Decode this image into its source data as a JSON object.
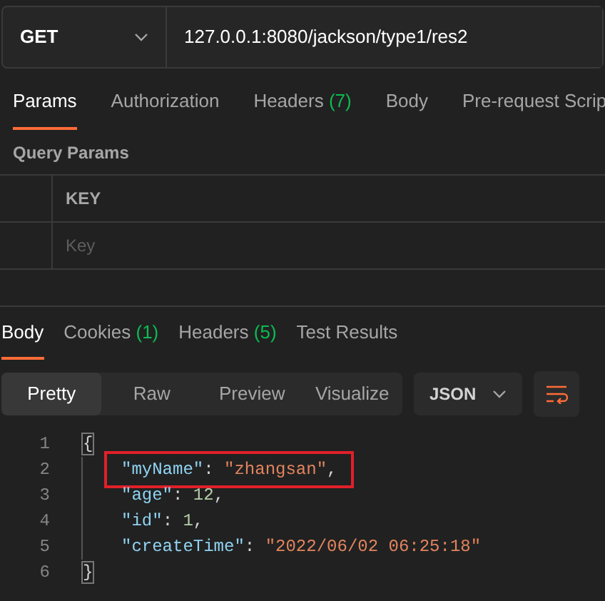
{
  "request": {
    "method": "GET",
    "url": "127.0.0.1:8080/jackson/type1/res2"
  },
  "request_tabs": [
    {
      "label": "Params",
      "selected": true
    },
    {
      "label": "Authorization",
      "selected": false
    },
    {
      "label": "Headers",
      "count": "(7)",
      "selected": false
    },
    {
      "label": "Body",
      "selected": false
    },
    {
      "label": "Pre-request Scrip",
      "selected": false
    }
  ],
  "query_params": {
    "title": "Query Params",
    "columns": [
      "KEY"
    ],
    "key_placeholder": "Key"
  },
  "response_tabs": [
    {
      "label": "Body",
      "selected": true
    },
    {
      "label": "Cookies",
      "count": "(1)",
      "selected": false
    },
    {
      "label": "Headers",
      "count": "(5)",
      "selected": false
    },
    {
      "label": "Test Results",
      "selected": false
    }
  ],
  "view_modes": [
    {
      "label": "Pretty",
      "selected": true
    },
    {
      "label": "Raw",
      "selected": false
    },
    {
      "label": "Preview",
      "selected": false
    },
    {
      "label": "Visualize",
      "selected": false
    }
  ],
  "format": "JSON",
  "code_lines": [
    {
      "number": "1",
      "highlighted": false,
      "tokens": [
        {
          "kind": "brace",
          "text": "{"
        }
      ]
    },
    {
      "number": "2",
      "highlighted": true,
      "tokens": [
        {
          "kind": "key",
          "text": "\"myName\""
        },
        {
          "kind": "punct",
          "text": ": "
        },
        {
          "kind": "string",
          "text": "\"zhangsan\""
        },
        {
          "kind": "punct",
          "text": ","
        }
      ]
    },
    {
      "number": "3",
      "highlighted": false,
      "tokens": [
        {
          "kind": "key",
          "text": "\"age\""
        },
        {
          "kind": "punct",
          "text": ": "
        },
        {
          "kind": "number",
          "text": "12"
        },
        {
          "kind": "punct",
          "text": ","
        }
      ]
    },
    {
      "number": "4",
      "highlighted": false,
      "tokens": [
        {
          "kind": "key",
          "text": "\"id\""
        },
        {
          "kind": "punct",
          "text": ": "
        },
        {
          "kind": "number",
          "text": "1"
        },
        {
          "kind": "punct",
          "text": ","
        }
      ]
    },
    {
      "number": "5",
      "highlighted": false,
      "tokens": [
        {
          "kind": "key",
          "text": "\"createTime\""
        },
        {
          "kind": "punct",
          "text": ": "
        },
        {
          "kind": "string",
          "text": "\"2022/06/02 06:25:18\""
        }
      ]
    },
    {
      "number": "6",
      "highlighted": false,
      "tokens": [
        {
          "kind": "brace",
          "text": "}"
        }
      ]
    }
  ]
}
